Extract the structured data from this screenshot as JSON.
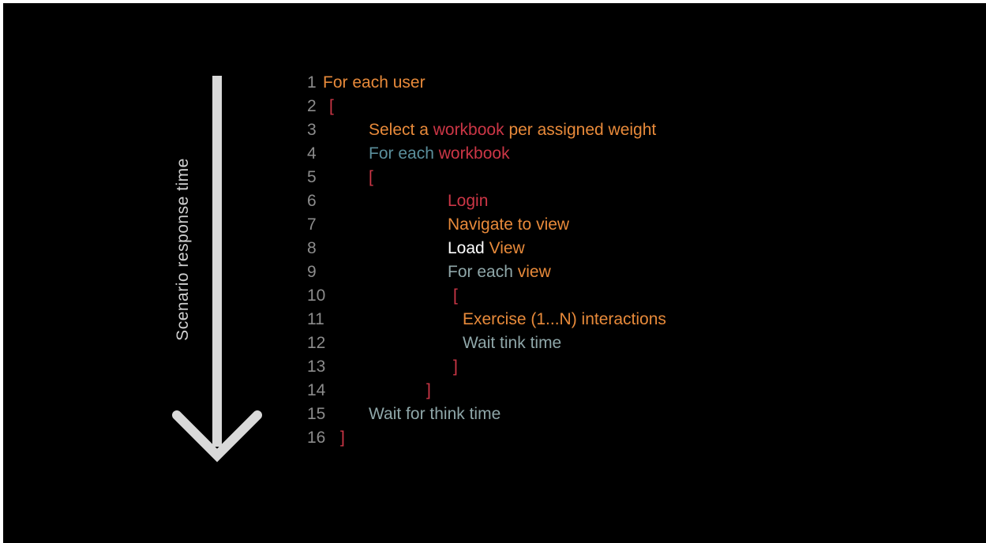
{
  "axis_label": "Scenario response time",
  "colors": {
    "background": "#000000",
    "arrow": "#d9d9d9",
    "line_number": "#8c8c8c",
    "orange": "#e88a3a",
    "red": "#cc3646",
    "teal": "#5b8f9c",
    "sage": "#8fa7a9",
    "white": "#ffffff"
  },
  "lines": [
    {
      "number": "1",
      "tokens": [
        {
          "text": "For each user",
          "color": "orange"
        }
      ]
    },
    {
      "number": "2",
      "tokens": [
        {
          "text": "[",
          "color": "red"
        }
      ]
    },
    {
      "number": "3",
      "tokens": [
        {
          "text": "Select a ",
          "color": "orange"
        },
        {
          "text": "workbook",
          "color": "red"
        },
        {
          "text": " per assigned weight",
          "color": "orange"
        }
      ]
    },
    {
      "number": "4",
      "tokens": [
        {
          "text": "For each ",
          "color": "teal"
        },
        {
          "text": "workbook",
          "color": "red"
        }
      ]
    },
    {
      "number": "5",
      "tokens": [
        {
          "text": "[",
          "color": "red"
        }
      ]
    },
    {
      "number": "6",
      "tokens": [
        {
          "text": "Login",
          "color": "red"
        }
      ]
    },
    {
      "number": "7",
      "tokens": [
        {
          "text": "Navigate to view",
          "color": "orange"
        }
      ]
    },
    {
      "number": "8",
      "tokens": [
        {
          "text": "Load ",
          "color": "white"
        },
        {
          "text": "View",
          "color": "orange"
        }
      ]
    },
    {
      "number": "9",
      "tokens": [
        {
          "text": "For each ",
          "color": "sage"
        },
        {
          "text": "view",
          "color": "orange"
        }
      ]
    },
    {
      "number": "10",
      "tokens": [
        {
          "text": "[",
          "color": "red"
        }
      ]
    },
    {
      "number": "11",
      "tokens": [
        {
          "text": "Exercise (1...N) interactions",
          "color": "orange"
        }
      ]
    },
    {
      "number": "12",
      "tokens": [
        {
          "text": "Wait tink time",
          "color": "sage"
        }
      ]
    },
    {
      "number": "13",
      "tokens": [
        {
          "text": "]",
          "color": "red"
        }
      ]
    },
    {
      "number": "14",
      "tokens": [
        {
          "text": "]",
          "color": "red"
        }
      ]
    },
    {
      "number": "15",
      "tokens": [
        {
          "text": "Wait for think time",
          "color": "sage"
        }
      ]
    },
    {
      "number": "16",
      "tokens": [
        {
          "text": "]",
          "color": "red"
        }
      ]
    }
  ]
}
